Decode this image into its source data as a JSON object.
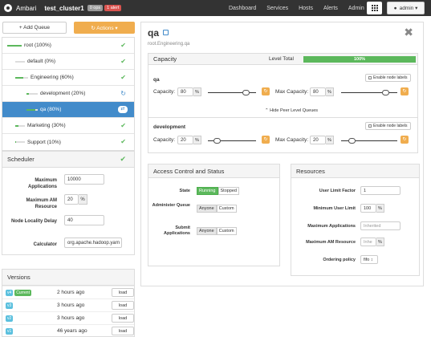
{
  "nav": {
    "brand": "Ambari",
    "cluster": "test_cluster1",
    "ops_badge": "0 ops",
    "alert_badge": "1 alert",
    "links": [
      "Dashboard",
      "Services",
      "Hosts",
      "Alerts",
      "Admin"
    ],
    "user": "admin ▾"
  },
  "toolbar": {
    "add_queue": "+ Add Queue",
    "actions": "↻ Actions ▾"
  },
  "queues": [
    {
      "label": "root (100%)",
      "status": "✔",
      "fill": 1.0
    },
    {
      "label": "default (0%)",
      "status": "✔",
      "fill": 0.0
    },
    {
      "label": "Engineering (60%)",
      "status": "✔",
      "fill": 0.6
    },
    {
      "label": "development (20%)",
      "status": "↻",
      "fill": 0.2
    },
    {
      "label": "qa (80%)",
      "status": "⇄",
      "fill": 0.8,
      "selected": true
    },
    {
      "label": "Marketing (30%)",
      "status": "✔",
      "fill": 0.3
    },
    {
      "label": "Support (10%)",
      "status": "✔",
      "fill": 0.1
    }
  ],
  "scheduler": {
    "title": "Scheduler",
    "max_apps_label": "Maximum Applications",
    "max_apps_value": "10000",
    "max_am_label": "Maximum AM Resource",
    "max_am_value": "20",
    "max_am_unit": "%",
    "locality_label": "Node Locality Delay",
    "locality_value": "40",
    "calculator_label": "Calculator",
    "calculator_value": "org.apache.hadoop.yarn"
  },
  "versions": {
    "title": "Versions",
    "rows": [
      {
        "tag": "v4",
        "current": "Current",
        "time": "2 hours ago",
        "action": "load"
      },
      {
        "tag": "v3",
        "current": "",
        "time": "3 hours ago",
        "action": "load"
      },
      {
        "tag": "v2",
        "current": "",
        "time": "3 hours ago",
        "action": "load"
      },
      {
        "tag": "v1",
        "current": "",
        "time": "46 years ago",
        "action": "load"
      }
    ]
  },
  "queue_detail": {
    "name": "qa",
    "path": "root.Engineering.qa",
    "capacity_title": "Capacity",
    "level_total_label": "Level Total",
    "level_total_value": "100%",
    "enable_labels": "Enable node labels",
    "hide_peer": "⌃ Hide Peer Level Queues",
    "capacity_label": "Capacity:",
    "max_capacity_label": "Max Capacity:",
    "pct": "%",
    "undo": "↻",
    "peers": [
      {
        "name": "qa",
        "capacity": "80",
        "max_capacity": "80",
        "cap_frac": 0.8,
        "max_frac": 0.8
      },
      {
        "name": "development",
        "capacity": "20",
        "max_capacity": "20",
        "cap_frac": 0.2,
        "max_frac": 0.2
      }
    ]
  },
  "access": {
    "title": "Access Control and Status",
    "state_label": "State",
    "state_options": [
      "Running",
      "Stopped"
    ],
    "administer_label": "Administer Queue",
    "submit_label": "Submit Applications",
    "acl_options": [
      "Anyone",
      "Custom"
    ]
  },
  "resources": {
    "title": "Resources",
    "user_limit_factor_label": "User Limit Factor",
    "user_limit_factor_value": "1",
    "min_user_limit_label": "Minimum User Limit",
    "min_user_limit_value": "100",
    "max_apps_label": "Maximum Applications",
    "max_apps_placeholder": "Inherited",
    "max_am_label": "Maximum AM Resource",
    "max_am_placeholder": "Inhe",
    "ordering_label": "Ordering policy",
    "ordering_value": "fifo ↕",
    "pct": "%"
  },
  "colors": {
    "accent": "#428bca",
    "success": "#5cb85c",
    "warning": "#f0ad4e",
    "danger": "#d9534f"
  }
}
